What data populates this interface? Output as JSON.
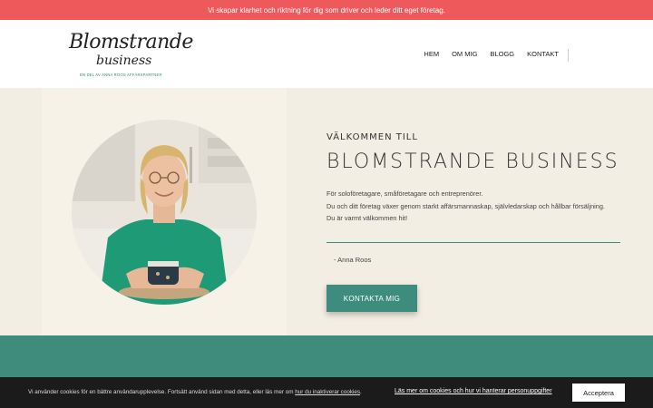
{
  "topbar": {
    "text": "Vi skapar klarhet och riktning för dig som driver och leder ditt eget företag."
  },
  "logo": {
    "line1": "Blomstrande",
    "line2": "business",
    "tagline": "EN DEL AV ANNA ROOS AFFÄRSPARTNER"
  },
  "nav": {
    "items": [
      "HEM",
      "OM MIG",
      "BLOGG",
      "KONTAKT"
    ]
  },
  "hero": {
    "welcome": "VÄLKOMMEN TILL",
    "brand": "BLOMSTRANDE BUSINESS",
    "lines": [
      "För soloföretagare, småföretagare och entreprenörer.",
      "Du och ditt företag växer genom starkt affärsmannaskap, självledarskap och hållbar försäljning.",
      "Du är varmt välkommen hit!"
    ],
    "signature": "- Anna Roos",
    "cta": "KONTAKTA MIG"
  },
  "cookie": {
    "text_before": "Vi använder cookies för en bättre användarupplevelse. Fortsätt använd sidan med detta, eller läs mer om ",
    "link_inline": "hur du inaktiverar cookies",
    "text_after": ".",
    "more_link": "Läs mer om cookies och hur vi hanterar personuppgifter",
    "accept": "Acceptera"
  },
  "colors": {
    "topbar": "#ee5a5c",
    "accent_green": "#3f8b7c",
    "hero_bg": "#f3eee3",
    "cookie_bg": "#1b1b1b"
  }
}
